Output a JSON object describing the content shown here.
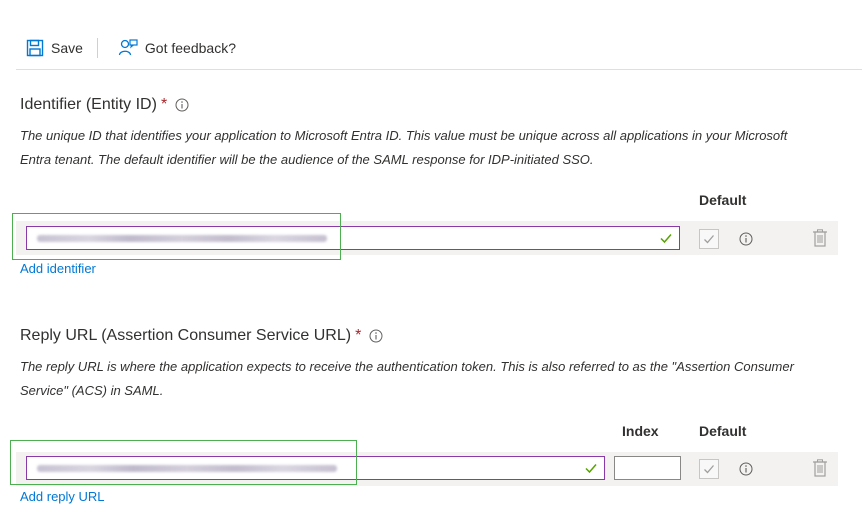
{
  "toolbar": {
    "save_label": "Save",
    "feedback_label": "Got feedback?"
  },
  "identifier": {
    "title": "Identifier (Entity ID)",
    "required_mark": "*",
    "description": "The unique ID that identifies your application to Microsoft Entra ID. This value must be unique across all applications in your Microsoft Entra tenant. The default identifier will be the audience of the SAML response for IDP-initiated SSO.",
    "default_header": "Default",
    "add_link": "Add identifier"
  },
  "reply_url": {
    "title": "Reply URL (Assertion Consumer Service URL)",
    "required_mark": "*",
    "description": "The reply URL is where the application expects to receive the authentication token. This is also referred to as the \"Assertion Consumer Service\" (ACS) in SAML.",
    "index_header": "Index",
    "default_header": "Default",
    "index_value": "",
    "add_link": "Add reply URL"
  },
  "colors": {
    "link": "#0078d4",
    "required": "#a4262c",
    "valid_check": "#57a300",
    "field_border": "#8a3aa8",
    "highlight": "#4caf50"
  },
  "icons": {
    "save": "save-icon",
    "feedback": "feedback-icon",
    "info": "info-icon",
    "check": "check-icon",
    "delete": "trash-icon"
  }
}
